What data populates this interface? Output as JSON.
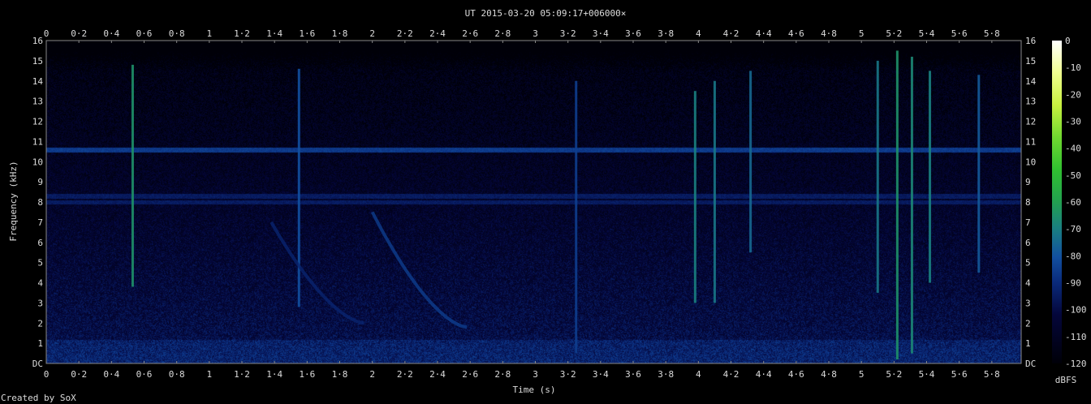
{
  "chart_data": {
    "type": "heatmap",
    "title": "UT 2015-03-20 05:09:17+006000×",
    "xlabel": "Time (s)",
    "ylabel": "Frequency (kHz)",
    "xlim": [
      0,
      5.98
    ],
    "ylim": [
      0,
      16
    ],
    "x_ticks": [
      "0",
      "0·2",
      "0·4",
      "0·6",
      "0·8",
      "1",
      "1·2",
      "1·4",
      "1·6",
      "1·8",
      "2",
      "2·2",
      "2·4",
      "2·6",
      "2·8",
      "3",
      "3·2",
      "3·4",
      "3·6",
      "3·8",
      "4",
      "4·2",
      "4·4",
      "4·6",
      "4·8",
      "5",
      "5·2",
      "5·4",
      "5·6",
      "5·8"
    ],
    "y_ticks": [
      "DC",
      "1",
      "2",
      "3",
      "4",
      "5",
      "6",
      "7",
      "8",
      "9",
      "10",
      "11",
      "12",
      "13",
      "14",
      "15",
      "16"
    ],
    "colorbar": {
      "label": "dBFS",
      "range": [
        -120,
        0
      ],
      "ticks": [
        "0",
        "-10",
        "-20",
        "-30",
        "-40",
        "-50",
        "-60",
        "-70",
        "-80",
        "-90",
        "-100",
        "-110",
        "-120"
      ]
    },
    "features": {
      "tone_khz": [
        10.6,
        8.3,
        8.0
      ],
      "background_dbfs": -100,
      "low_band_khz": [
        0,
        1.2
      ],
      "impulses": [
        {
          "t": 0.53,
          "f_lo": 3.8,
          "f_hi": 14.8,
          "level": -65
        },
        {
          "t": 1.55,
          "f_lo": 2.8,
          "f_hi": 14.6,
          "level": -80
        },
        {
          "t": 3.25,
          "f_lo": 0.5,
          "f_hi": 14.0,
          "level": -85
        },
        {
          "t": 3.98,
          "f_lo": 3.0,
          "f_hi": 13.5,
          "level": -70
        },
        {
          "t": 4.1,
          "f_lo": 3.0,
          "f_hi": 14.0,
          "level": -72
        },
        {
          "t": 4.32,
          "f_lo": 5.5,
          "f_hi": 14.5,
          "level": -75
        },
        {
          "t": 5.1,
          "f_lo": 3.5,
          "f_hi": 15.0,
          "level": -72
        },
        {
          "t": 5.22,
          "f_lo": 0.2,
          "f_hi": 15.5,
          "level": -65
        },
        {
          "t": 5.31,
          "f_lo": 0.5,
          "f_hi": 15.2,
          "level": -68
        },
        {
          "t": 5.42,
          "f_lo": 4.0,
          "f_hi": 14.5,
          "level": -70
        },
        {
          "t": 5.72,
          "f_lo": 4.5,
          "f_hi": 14.3,
          "level": -78
        }
      ],
      "sweeps": [
        {
          "t_start": 2.0,
          "f_start": 7.5,
          "t_end": 2.58,
          "f_end": 1.8,
          "level": -85
        },
        {
          "t_start": 1.38,
          "f_start": 7.0,
          "t_end": 1.95,
          "f_end": 2.0,
          "level": -92
        }
      ]
    },
    "grid": false,
    "legend": "none"
  },
  "footer": {
    "credit": "Created by SoX"
  }
}
